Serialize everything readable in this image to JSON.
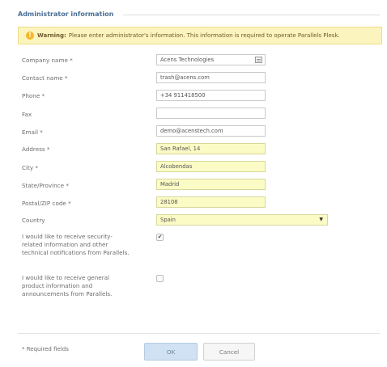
{
  "section": {
    "title": "Administrator information"
  },
  "warning": {
    "icon": "exclamation-icon",
    "bold": "Warning:",
    "text": "Please enter administrator's information. This information is required to operate Parallels Plesk."
  },
  "fields": {
    "company": {
      "label": "Company name *",
      "value": "Acens Technologies"
    },
    "contact": {
      "label": "Contact name *",
      "value": "trash@acens.com"
    },
    "phone": {
      "label": "Phone *",
      "value": "+34 911418500"
    },
    "fax": {
      "label": "Fax",
      "value": ""
    },
    "email": {
      "label": "Email *",
      "value": "demo@acenstech.com"
    },
    "address": {
      "label": "Address *",
      "value": "San Rafael, 14"
    },
    "city": {
      "label": "City *",
      "value": "Alcobendas"
    },
    "state": {
      "label": "State/Province *",
      "value": "Madrid"
    },
    "postal": {
      "label": "Postal/ZIP code *",
      "value": "28108"
    },
    "country": {
      "label": "Country",
      "value": "Spain"
    }
  },
  "checkboxes": {
    "security": {
      "label": "I would like to receive security-related information and other technical notifications from Parallels.",
      "checked": true,
      "mark": "✔"
    },
    "product": {
      "label": "I would like to receive general product information and announcements from Parallels.",
      "checked": false,
      "mark": ""
    }
  },
  "footer": {
    "required_note": "* Required fields",
    "ok_label": "OK",
    "cancel_label": "Cancel"
  },
  "colors": {
    "title": "#4a6f96",
    "warning_bg": "#fcf4bf",
    "highlight_field": "#fbfbc6",
    "ok_button": "#cfe1f2"
  }
}
